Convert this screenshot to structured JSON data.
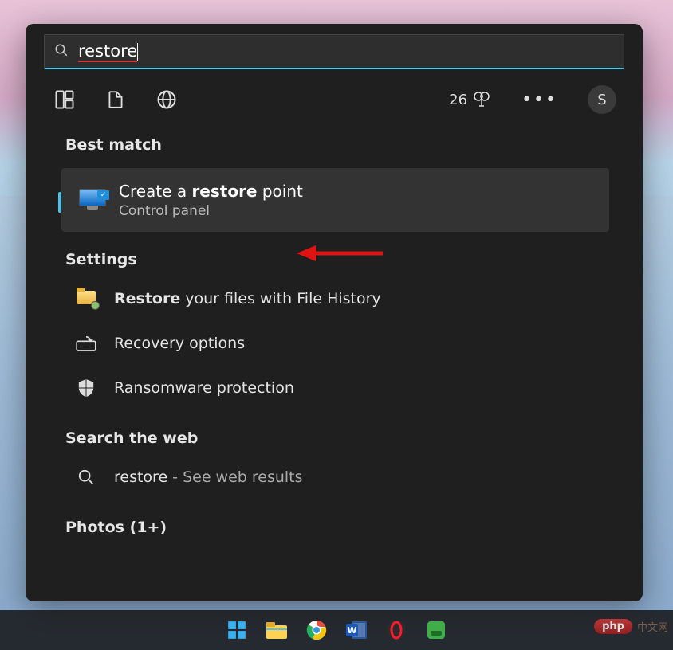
{
  "search": {
    "query": "restore"
  },
  "rewards": {
    "points": "26"
  },
  "user": {
    "initial": "S"
  },
  "sections": {
    "best_match": "Best match",
    "settings": "Settings",
    "web": "Search the web",
    "photos": "Photos (1+)"
  },
  "best_match_result": {
    "title_pre": "Create a ",
    "title_bold": "restore",
    "title_post": " point",
    "subtitle": "Control panel"
  },
  "settings_results": [
    {
      "bold": "Restore",
      "rest": " your files with File History"
    },
    {
      "bold": "",
      "rest": "Recovery options"
    },
    {
      "bold": "",
      "rest": "Ransomware protection"
    }
  ],
  "web_result": {
    "query": "restore",
    "suffix": " - See web results"
  },
  "watermark": {
    "pill": "php",
    "text": "中文网"
  }
}
